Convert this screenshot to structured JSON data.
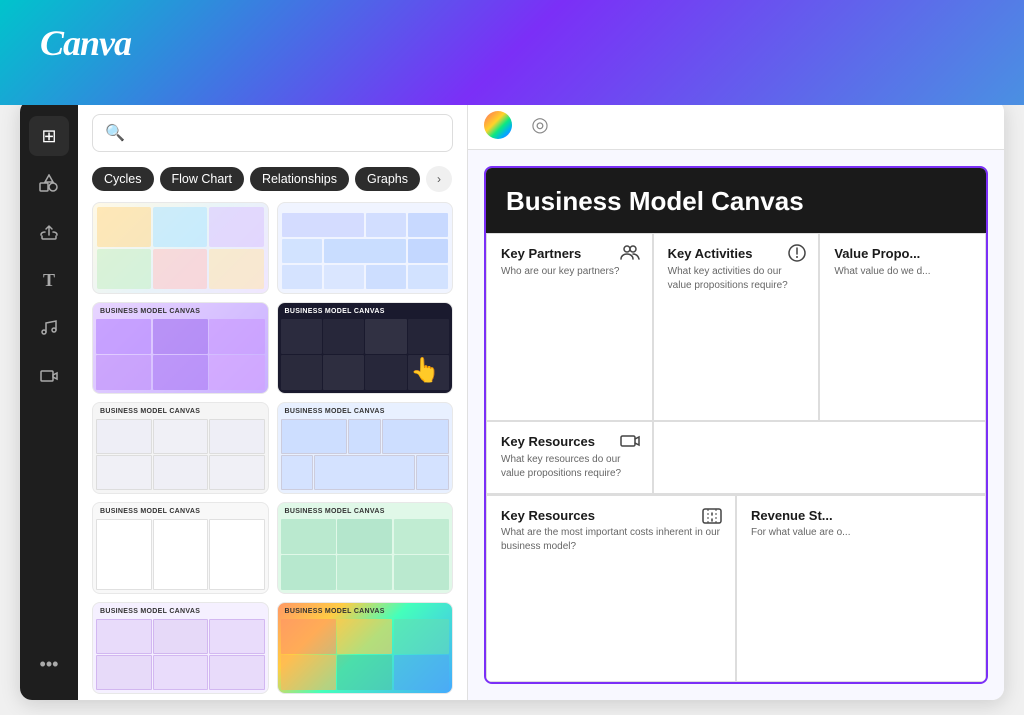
{
  "header": {
    "logo": "Canva"
  },
  "sidebar": {
    "icons": [
      {
        "name": "layout-icon",
        "symbol": "⊞",
        "active": false
      },
      {
        "name": "shapes-icon",
        "symbol": "❖",
        "active": false
      },
      {
        "name": "upload-icon",
        "symbol": "☁",
        "active": false
      },
      {
        "name": "text-icon",
        "symbol": "T",
        "active": false
      },
      {
        "name": "music-icon",
        "symbol": "♫",
        "active": false
      },
      {
        "name": "video-icon",
        "symbol": "▶",
        "active": false
      }
    ],
    "more": "•••"
  },
  "search": {
    "placeholder": "",
    "value": ""
  },
  "categories": [
    {
      "label": "Cycles",
      "active": false
    },
    {
      "label": "Flow Chart",
      "active": false
    },
    {
      "label": "Relationships",
      "active": false
    },
    {
      "label": "Graphs",
      "active": false
    }
  ],
  "templates": [
    {
      "id": 1,
      "label": "",
      "class": "t1"
    },
    {
      "id": 2,
      "label": "",
      "class": "t2"
    },
    {
      "id": 3,
      "label": "BUSINESS MODEL CANVAS",
      "class": "t3",
      "labelDark": false
    },
    {
      "id": 4,
      "label": "Business Model Canvas",
      "class": "t4",
      "labelDark": true
    },
    {
      "id": 5,
      "label": "Business Model Canvas",
      "class": "t5",
      "labelDark": false
    },
    {
      "id": 6,
      "label": "Business Model Canvas",
      "class": "t6",
      "labelDark": false
    },
    {
      "id": 7,
      "label": "Business Model Canvas",
      "class": "t7",
      "labelDark": false
    },
    {
      "id": 8,
      "label": "Business Model Canvas",
      "class": "t8",
      "labelDark": false
    },
    {
      "id": 9,
      "label": "BUSINESS MODEL CANVAS",
      "class": "t9",
      "labelDark": false
    },
    {
      "id": 10,
      "label": "BUSINESS MODEL CANVAS",
      "class": "t10",
      "labelDark": false
    }
  ],
  "preview": {
    "title": "Business Model Canvas",
    "toolbar": {
      "gradient_icon": "🎨",
      "circle_icon": "◎"
    },
    "cells": [
      {
        "title": "Key Partners",
        "desc": "Who are our key partners?",
        "icon": "👥"
      },
      {
        "title": "Key Activities",
        "desc": "What key activities do our value propositions require?",
        "icon": "ℹ"
      },
      {
        "title": "Value Propo",
        "desc": "What value do we d",
        "icon": ""
      },
      {
        "title": "Key Resources",
        "desc": "What key resources do our value propositions require?",
        "icon": "📦"
      }
    ],
    "bottom_cells": [
      {
        "title": "Key Resources",
        "desc": "What are the most important costs inherent in our business model?",
        "icon": "📤"
      },
      {
        "title": "Revenue St",
        "desc": "For what value are o",
        "icon": ""
      }
    ]
  }
}
